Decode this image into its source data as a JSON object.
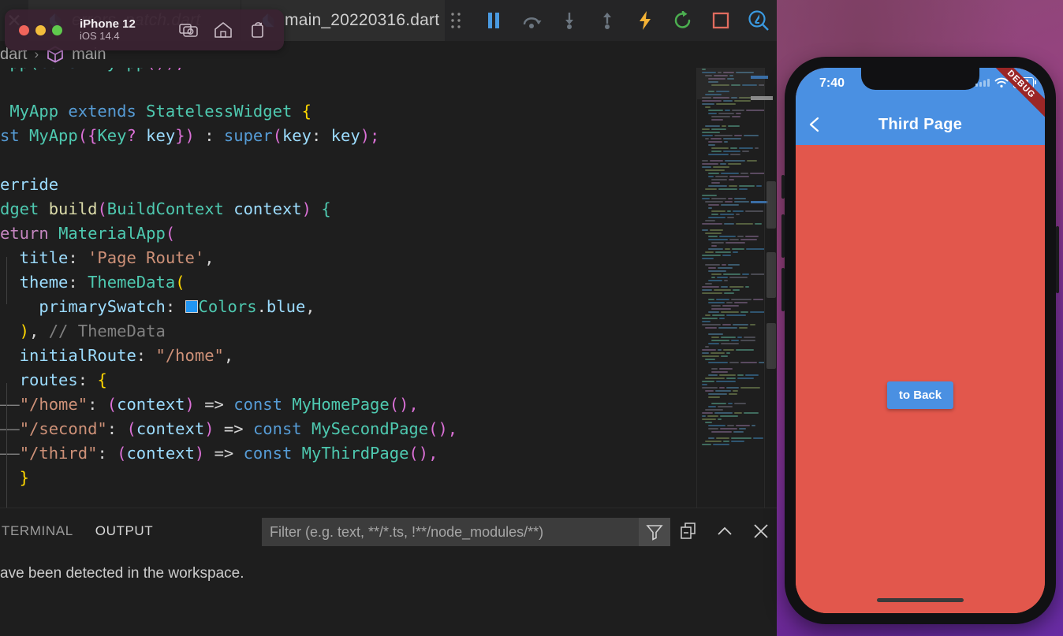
{
  "editor": {
    "tabs": [
      {
        "label": "",
        "icon": "close-icon",
        "state": "partial"
      },
      {
        "label": "errors_patch.dart",
        "icon": "dart-file-icon",
        "state": "inactive"
      },
      {
        "label": "main_20220316.dart",
        "icon": "dart-file-icon",
        "state": "active"
      }
    ],
    "toolbar": [
      {
        "name": "drag-handle-icon",
        "title": "Drag"
      },
      {
        "name": "pause-icon",
        "title": "Pause"
      },
      {
        "name": "step-over-icon",
        "title": "Step Over"
      },
      {
        "name": "step-into-icon",
        "title": "Step Into"
      },
      {
        "name": "step-out-icon",
        "title": "Step Out"
      },
      {
        "name": "hot-reload-icon",
        "title": "Hot Reload"
      },
      {
        "name": "hot-restart-icon",
        "title": "Hot Restart"
      },
      {
        "name": "stop-icon",
        "title": "Stop"
      },
      {
        "name": "flutter-inspector-icon",
        "title": "Open DevTools"
      }
    ],
    "breadcrumb": {
      "file": "dart",
      "separator": "›",
      "symbol": "main",
      "symbol_icon": "cube-icon"
    },
    "code_lines": [
      [
        {
          "t": "App(",
          "c": "k-type"
        },
        {
          "t": "const ",
          "c": "k-blue"
        },
        {
          "t": "MyApp",
          "c": "k-type"
        },
        {
          "t": "());",
          "c": "k-br2"
        }
      ],
      [],
      [
        {
          "t": " MyApp ",
          "c": "k-type"
        },
        {
          "t": "extends ",
          "c": "k-blue"
        },
        {
          "t": "StatelessWidget ",
          "c": "k-type"
        },
        {
          "t": "{",
          "c": "k-br1"
        }
      ],
      [
        {
          "t": "st ",
          "c": "k-blue"
        },
        {
          "t": "MyApp",
          "c": "k-type"
        },
        {
          "t": "(",
          "c": "k-br2"
        },
        {
          "t": "{",
          "c": "k-br2"
        },
        {
          "t": "Key",
          "c": "k-type"
        },
        {
          "t": "? ",
          "c": "k-br2"
        },
        {
          "t": "key",
          "c": "k-var"
        },
        {
          "t": "}",
          "c": "k-br2"
        },
        {
          "t": ") ",
          "c": "k-br2"
        },
        {
          "t": ": ",
          "c": "k-plain"
        },
        {
          "t": "super",
          "c": "k-blue"
        },
        {
          "t": "(",
          "c": "k-br2"
        },
        {
          "t": "key",
          "c": "k-var"
        },
        {
          "t": ": ",
          "c": "k-plain"
        },
        {
          "t": "key",
          "c": "k-var"
        },
        {
          "t": ");",
          "c": "k-br2"
        }
      ],
      [],
      [
        {
          "t": "erride",
          "c": "k-var"
        }
      ],
      [
        {
          "t": "dget ",
          "c": "k-type"
        },
        {
          "t": "build",
          "c": "k-fn"
        },
        {
          "t": "(",
          "c": "k-br2"
        },
        {
          "t": "BuildContext ",
          "c": "k-type"
        },
        {
          "t": "context",
          "c": "k-var"
        },
        {
          "t": ") ",
          "c": "k-br2"
        },
        {
          "t": "{",
          "c": "k-type"
        }
      ],
      [
        {
          "t": "eturn ",
          "c": "k-kw"
        },
        {
          "t": "MaterialApp",
          "c": "k-type"
        },
        {
          "t": "(",
          "c": "k-br2"
        }
      ],
      [
        {
          "t": "  title",
          "c": "k-var"
        },
        {
          "t": ": ",
          "c": "k-plain"
        },
        {
          "t": "'Page Route'",
          "c": "k-str"
        },
        {
          "t": ",",
          "c": "k-plain"
        }
      ],
      [
        {
          "t": "  theme",
          "c": "k-var"
        },
        {
          "t": ": ",
          "c": "k-plain"
        },
        {
          "t": "ThemeData",
          "c": "k-type"
        },
        {
          "t": "(",
          "c": "k-br1"
        }
      ],
      [
        {
          "t": "    primarySwatch",
          "c": "k-var"
        },
        {
          "t": ": ",
          "c": "k-plain"
        },
        {
          "t": "@SWATCH@",
          "c": "swatch"
        },
        {
          "t": "Colors",
          "c": "k-type"
        },
        {
          "t": ".",
          "c": "k-plain"
        },
        {
          "t": "blue",
          "c": "k-var"
        },
        {
          "t": ",",
          "c": "k-plain"
        }
      ],
      [
        {
          "t": "  )",
          "c": "k-br1"
        },
        {
          "t": ", ",
          "c": "k-plain"
        },
        {
          "t": "// ThemeData",
          "c": "k-cmt2"
        }
      ],
      [
        {
          "t": "  initialRoute",
          "c": "k-var"
        },
        {
          "t": ": ",
          "c": "k-plain"
        },
        {
          "t": "\"/home\"",
          "c": "k-str"
        },
        {
          "t": ",",
          "c": "k-plain"
        }
      ],
      [
        {
          "t": "  routes",
          "c": "k-var"
        },
        {
          "t": ": ",
          "c": "k-plain"
        },
        {
          "t": "{",
          "c": "k-br1"
        }
      ],
      [
        {
          "t": "——",
          "c": "k-cmt2"
        },
        {
          "t": "\"/home\"",
          "c": "k-str"
        },
        {
          "t": ": ",
          "c": "k-plain"
        },
        {
          "t": "(",
          "c": "k-br2"
        },
        {
          "t": "context",
          "c": "k-var"
        },
        {
          "t": ") ",
          "c": "k-br2"
        },
        {
          "t": "=> ",
          "c": "k-plain"
        },
        {
          "t": "const ",
          "c": "k-blue"
        },
        {
          "t": "MyHomePage",
          "c": "k-type"
        },
        {
          "t": "(),",
          "c": "k-br2"
        }
      ],
      [
        {
          "t": "——",
          "c": "k-cmt2"
        },
        {
          "t": "\"/second\"",
          "c": "k-str"
        },
        {
          "t": ": ",
          "c": "k-plain"
        },
        {
          "t": "(",
          "c": "k-br2"
        },
        {
          "t": "context",
          "c": "k-var"
        },
        {
          "t": ") ",
          "c": "k-br2"
        },
        {
          "t": "=> ",
          "c": "k-plain"
        },
        {
          "t": "const ",
          "c": "k-blue"
        },
        {
          "t": "MySecondPage",
          "c": "k-type"
        },
        {
          "t": "(),",
          "c": "k-br2"
        }
      ],
      [
        {
          "t": "——",
          "c": "k-cmt2"
        },
        {
          "t": "\"/third\"",
          "c": "k-str"
        },
        {
          "t": ": ",
          "c": "k-plain"
        },
        {
          "t": "(",
          "c": "k-br2"
        },
        {
          "t": "context",
          "c": "k-var"
        },
        {
          "t": ") ",
          "c": "k-br2"
        },
        {
          "t": "=> ",
          "c": "k-plain"
        },
        {
          "t": "const ",
          "c": "k-blue"
        },
        {
          "t": "MyThirdPage",
          "c": "k-type"
        },
        {
          "t": "(),",
          "c": "k-br2"
        }
      ],
      [
        {
          "t": "  }",
          "c": "k-br1"
        }
      ]
    ]
  },
  "panel": {
    "tabs": [
      {
        "label": "TERMINAL",
        "active": false
      },
      {
        "label": "OUTPUT",
        "active": true
      }
    ],
    "filter": {
      "value": "",
      "placeholder": "Filter (e.g. text, **/*.ts, !**/node_modules/**)",
      "filter_icon": "funnel-icon"
    },
    "actions": [
      {
        "name": "clear-output-icon"
      },
      {
        "name": "chevron-up-icon"
      },
      {
        "name": "close-panel-icon"
      }
    ],
    "body_text": "ave been detected in the workspace."
  },
  "simulator": {
    "window": {
      "device_name": "iPhone 12",
      "os_version": "iOS 14.4",
      "traffic_lights": [
        "close",
        "minimize",
        "zoom"
      ],
      "actions": [
        {
          "name": "screenshot-icon"
        },
        {
          "name": "home-icon"
        },
        {
          "name": "rotate-icon"
        }
      ]
    },
    "screen": {
      "status_bar": {
        "time": "7:40",
        "wifi_icon": "wifi-icon",
        "battery_icon": "battery-icon"
      },
      "app_bar": {
        "back_icon": "chevron-left-icon",
        "title": "Third Page",
        "color": "#4a90e2"
      },
      "background_color": "#e2574c",
      "button_label": "to Back",
      "debug_banner": "DEBUG"
    }
  },
  "colors": {
    "editor_bg": "#1e1e1e",
    "tab_bg": "#2d2d2d",
    "accent_blue": "#4a90e2",
    "page_red": "#e2574c",
    "debug_red": "#9b2626"
  }
}
